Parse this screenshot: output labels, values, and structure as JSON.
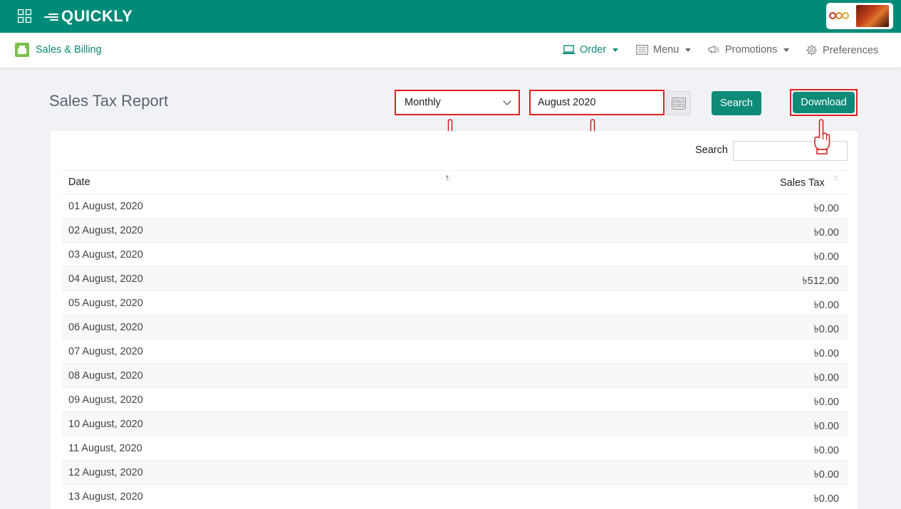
{
  "topbar": {
    "brand": "QUICKLY",
    "logo_icon": "speed-lines-icon",
    "apps_icon": "grid-icon",
    "accent_color": "#008b78"
  },
  "navbar": {
    "app_title": "Sales & Billing",
    "items": [
      {
        "label": "Order",
        "icon": "laptop-icon",
        "active": true
      },
      {
        "label": "Menu",
        "icon": "menu-list-icon",
        "active": false
      },
      {
        "label": "Promotions",
        "icon": "megaphone-icon",
        "active": false
      },
      {
        "label": "Preferences",
        "icon": "gear-icon",
        "active": false
      }
    ]
  },
  "report": {
    "title": "Sales Tax Report",
    "period": "Monthly",
    "date_value": "August 2020",
    "search_label": "Search",
    "download_label": "Download"
  },
  "table": {
    "search_label": "Search",
    "search_value": "",
    "columns": [
      "Date",
      "Sales Tax"
    ],
    "sort_icons": [
      "sort-asc-icon",
      "sort-icon"
    ],
    "rows": [
      {
        "date": "01 August, 2020",
        "tax": "৳0.00"
      },
      {
        "date": "02 August, 2020",
        "tax": "৳0.00"
      },
      {
        "date": "03 August, 2020",
        "tax": "৳0.00"
      },
      {
        "date": "04 August, 2020",
        "tax": "৳512.00"
      },
      {
        "date": "05 August, 2020",
        "tax": "৳0.00"
      },
      {
        "date": "06 August, 2020",
        "tax": "৳0.00"
      },
      {
        "date": "07 August, 2020",
        "tax": "৳0.00"
      },
      {
        "date": "08 August, 2020",
        "tax": "৳0.00"
      },
      {
        "date": "09 August, 2020",
        "tax": "৳0.00"
      },
      {
        "date": "10 August, 2020",
        "tax": "৳0.00"
      },
      {
        "date": "11 August, 2020",
        "tax": "৳0.00"
      },
      {
        "date": "12 August, 2020",
        "tax": "৳0.00"
      },
      {
        "date": "13 August, 2020",
        "tax": "৳0.00"
      }
    ]
  },
  "annotations": {
    "highlight_color": "#e02020",
    "pointer_icon": "hand-pointer-icon"
  }
}
